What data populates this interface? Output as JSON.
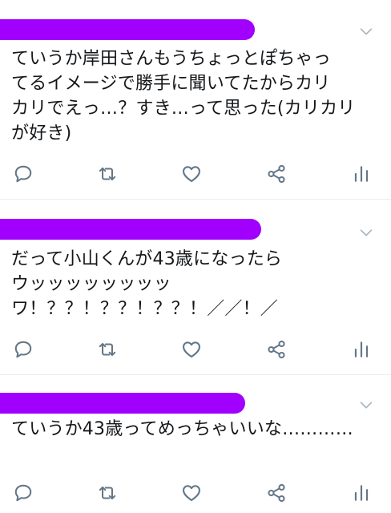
{
  "tweets": [
    {
      "text": "ていうか岸田さんもうちょっとぽちゃっ\nてるイメージで勝手に聞いてたからカリ\nカリでえっ…？すき…って思った(カリカリ\nが好き)"
    },
    {
      "text": "だって小山くんが43歳になったら\nウッッッッッッッッ\nワ！？？！？？！？？！／／！／"
    },
    {
      "text": "ていうか43歳ってめっちゃいいな…………"
    }
  ],
  "icons": {
    "reply": "reply-icon",
    "retweet": "retweet-icon",
    "like": "heart-icon",
    "share": "share-icon",
    "analytics": "analytics-icon",
    "menu": "chevron-down-icon"
  },
  "colors": {
    "redaction": "#a100ff",
    "icon": "#657786",
    "divider": "#e6ecf0"
  }
}
